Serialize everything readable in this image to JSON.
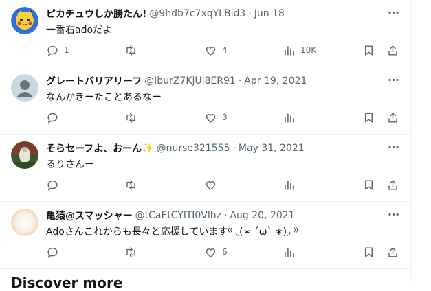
{
  "tweets": [
    {
      "name": "ピカチュウしか勝たん!",
      "handle": "@9hdb7c7xqYLBid3",
      "separator": "·",
      "date": "Jun 18",
      "text": "一番右adoだよ",
      "replies": "1",
      "retweets": "",
      "likes": "4",
      "views": "10K",
      "avatar": "pikachu-avatar",
      "avatar_color": "#2e6fd8"
    },
    {
      "name": "グレートバリアリーフ",
      "handle": "@IburZ7KjUl8ER91",
      "separator": "·",
      "date": "Apr 19, 2021",
      "text": "なんかきーたことあるなー",
      "replies": "",
      "retweets": "",
      "likes": "3",
      "views": "",
      "avatar": "default-profile-avatar",
      "avatar_color": "#ccd6dd"
    },
    {
      "name": "そらセーフよ、おーん",
      "name_emoji": "✨",
      "handle": "@nurse321555",
      "separator": "·",
      "date": "May 31, 2021",
      "text": "るりさんー",
      "replies": "",
      "retweets": "",
      "likes": "",
      "views": "",
      "avatar": "photo-avatar",
      "avatar_color": "#5a3b2a"
    },
    {
      "name": "亀猿@スマッシャー",
      "handle": "@tCaEtCYlTI0Vlhz",
      "separator": "·",
      "date": "Aug 20, 2021",
      "text": "Adoさんこれからも長々と応援しています⁽⁽ ◟(∗ ˊωˋ ∗)◞ ⁾⁾",
      "replies": "",
      "retweets": "",
      "likes": "6",
      "views": "",
      "avatar": "blurred-avatar",
      "avatar_color": "#f6e6d6"
    }
  ],
  "next_section": {
    "title": "Discover more"
  },
  "colors": {
    "text_primary": "#0f1419",
    "text_secondary": "#536471",
    "divider": "#eff3f4"
  },
  "icons": [
    "more-icon",
    "reply-icon",
    "retweet-icon",
    "like-icon",
    "views-icon",
    "bookmark-icon",
    "share-icon"
  ]
}
